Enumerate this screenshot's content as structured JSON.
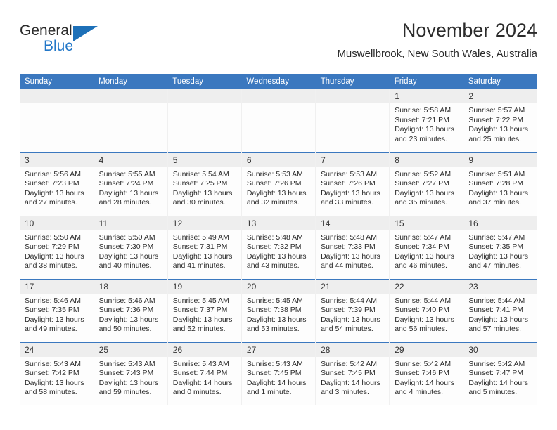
{
  "brand": {
    "word_top": "General",
    "word_bottom": "Blue",
    "accent_color": "#1d70b8"
  },
  "header": {
    "title": "November 2024",
    "location": "Muswellbrook, New South Wales, Australia"
  },
  "theme": {
    "header_blue": "#3b78bf",
    "daynum_gray": "#eeeeee",
    "text": "#2b2b2b"
  },
  "weekday_headers": [
    "Sunday",
    "Monday",
    "Tuesday",
    "Wednesday",
    "Thursday",
    "Friday",
    "Saturday"
  ],
  "labels": {
    "sunrise_prefix": "Sunrise:",
    "sunset_prefix": "Sunset:",
    "daylight_prefix": "Daylight:"
  },
  "weeks": [
    [
      {
        "day": "",
        "sunrise": "",
        "sunset": "",
        "daylight": ""
      },
      {
        "day": "",
        "sunrise": "",
        "sunset": "",
        "daylight": ""
      },
      {
        "day": "",
        "sunrise": "",
        "sunset": "",
        "daylight": ""
      },
      {
        "day": "",
        "sunrise": "",
        "sunset": "",
        "daylight": ""
      },
      {
        "day": "",
        "sunrise": "",
        "sunset": "",
        "daylight": ""
      },
      {
        "day": "1",
        "sunrise": "Sunrise: 5:58 AM",
        "sunset": "Sunset: 7:21 PM",
        "daylight": "Daylight: 13 hours and 23 minutes."
      },
      {
        "day": "2",
        "sunrise": "Sunrise: 5:57 AM",
        "sunset": "Sunset: 7:22 PM",
        "daylight": "Daylight: 13 hours and 25 minutes."
      }
    ],
    [
      {
        "day": "3",
        "sunrise": "Sunrise: 5:56 AM",
        "sunset": "Sunset: 7:23 PM",
        "daylight": "Daylight: 13 hours and 27 minutes."
      },
      {
        "day": "4",
        "sunrise": "Sunrise: 5:55 AM",
        "sunset": "Sunset: 7:24 PM",
        "daylight": "Daylight: 13 hours and 28 minutes."
      },
      {
        "day": "5",
        "sunrise": "Sunrise: 5:54 AM",
        "sunset": "Sunset: 7:25 PM",
        "daylight": "Daylight: 13 hours and 30 minutes."
      },
      {
        "day": "6",
        "sunrise": "Sunrise: 5:53 AM",
        "sunset": "Sunset: 7:26 PM",
        "daylight": "Daylight: 13 hours and 32 minutes."
      },
      {
        "day": "7",
        "sunrise": "Sunrise: 5:53 AM",
        "sunset": "Sunset: 7:26 PM",
        "daylight": "Daylight: 13 hours and 33 minutes."
      },
      {
        "day": "8",
        "sunrise": "Sunrise: 5:52 AM",
        "sunset": "Sunset: 7:27 PM",
        "daylight": "Daylight: 13 hours and 35 minutes."
      },
      {
        "day": "9",
        "sunrise": "Sunrise: 5:51 AM",
        "sunset": "Sunset: 7:28 PM",
        "daylight": "Daylight: 13 hours and 37 minutes."
      }
    ],
    [
      {
        "day": "10",
        "sunrise": "Sunrise: 5:50 AM",
        "sunset": "Sunset: 7:29 PM",
        "daylight": "Daylight: 13 hours and 38 minutes."
      },
      {
        "day": "11",
        "sunrise": "Sunrise: 5:50 AM",
        "sunset": "Sunset: 7:30 PM",
        "daylight": "Daylight: 13 hours and 40 minutes."
      },
      {
        "day": "12",
        "sunrise": "Sunrise: 5:49 AM",
        "sunset": "Sunset: 7:31 PM",
        "daylight": "Daylight: 13 hours and 41 minutes."
      },
      {
        "day": "13",
        "sunrise": "Sunrise: 5:48 AM",
        "sunset": "Sunset: 7:32 PM",
        "daylight": "Daylight: 13 hours and 43 minutes."
      },
      {
        "day": "14",
        "sunrise": "Sunrise: 5:48 AM",
        "sunset": "Sunset: 7:33 PM",
        "daylight": "Daylight: 13 hours and 44 minutes."
      },
      {
        "day": "15",
        "sunrise": "Sunrise: 5:47 AM",
        "sunset": "Sunset: 7:34 PM",
        "daylight": "Daylight: 13 hours and 46 minutes."
      },
      {
        "day": "16",
        "sunrise": "Sunrise: 5:47 AM",
        "sunset": "Sunset: 7:35 PM",
        "daylight": "Daylight: 13 hours and 47 minutes."
      }
    ],
    [
      {
        "day": "17",
        "sunrise": "Sunrise: 5:46 AM",
        "sunset": "Sunset: 7:35 PM",
        "daylight": "Daylight: 13 hours and 49 minutes."
      },
      {
        "day": "18",
        "sunrise": "Sunrise: 5:46 AM",
        "sunset": "Sunset: 7:36 PM",
        "daylight": "Daylight: 13 hours and 50 minutes."
      },
      {
        "day": "19",
        "sunrise": "Sunrise: 5:45 AM",
        "sunset": "Sunset: 7:37 PM",
        "daylight": "Daylight: 13 hours and 52 minutes."
      },
      {
        "day": "20",
        "sunrise": "Sunrise: 5:45 AM",
        "sunset": "Sunset: 7:38 PM",
        "daylight": "Daylight: 13 hours and 53 minutes."
      },
      {
        "day": "21",
        "sunrise": "Sunrise: 5:44 AM",
        "sunset": "Sunset: 7:39 PM",
        "daylight": "Daylight: 13 hours and 54 minutes."
      },
      {
        "day": "22",
        "sunrise": "Sunrise: 5:44 AM",
        "sunset": "Sunset: 7:40 PM",
        "daylight": "Daylight: 13 hours and 56 minutes."
      },
      {
        "day": "23",
        "sunrise": "Sunrise: 5:44 AM",
        "sunset": "Sunset: 7:41 PM",
        "daylight": "Daylight: 13 hours and 57 minutes."
      }
    ],
    [
      {
        "day": "24",
        "sunrise": "Sunrise: 5:43 AM",
        "sunset": "Sunset: 7:42 PM",
        "daylight": "Daylight: 13 hours and 58 minutes."
      },
      {
        "day": "25",
        "sunrise": "Sunrise: 5:43 AM",
        "sunset": "Sunset: 7:43 PM",
        "daylight": "Daylight: 13 hours and 59 minutes."
      },
      {
        "day": "26",
        "sunrise": "Sunrise: 5:43 AM",
        "sunset": "Sunset: 7:44 PM",
        "daylight": "Daylight: 14 hours and 0 minutes."
      },
      {
        "day": "27",
        "sunrise": "Sunrise: 5:43 AM",
        "sunset": "Sunset: 7:45 PM",
        "daylight": "Daylight: 14 hours and 1 minute."
      },
      {
        "day": "28",
        "sunrise": "Sunrise: 5:42 AM",
        "sunset": "Sunset: 7:45 PM",
        "daylight": "Daylight: 14 hours and 3 minutes."
      },
      {
        "day": "29",
        "sunrise": "Sunrise: 5:42 AM",
        "sunset": "Sunset: 7:46 PM",
        "daylight": "Daylight: 14 hours and 4 minutes."
      },
      {
        "day": "30",
        "sunrise": "Sunrise: 5:42 AM",
        "sunset": "Sunset: 7:47 PM",
        "daylight": "Daylight: 14 hours and 5 minutes."
      }
    ]
  ]
}
